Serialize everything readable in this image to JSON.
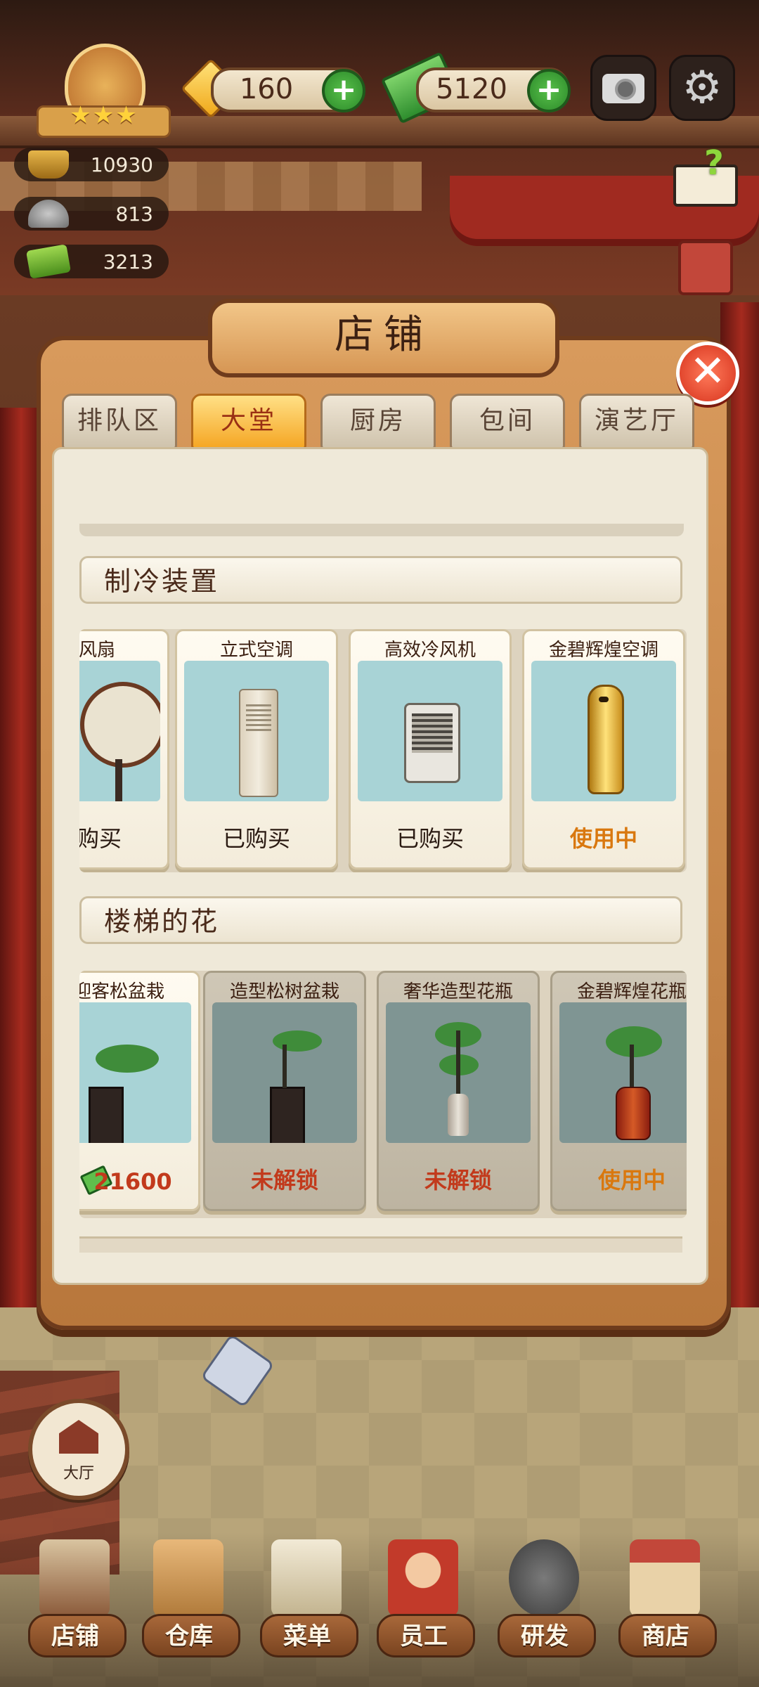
{
  "hud": {
    "gems": "160",
    "cash": "5120",
    "stats": [
      "10930",
      "813",
      "3213"
    ]
  },
  "panel": {
    "title": "店铺",
    "tabs": [
      "排队区",
      "大堂",
      "厨房",
      "包间",
      "演艺厅"
    ],
    "active_tab_index": 1,
    "sections": [
      {
        "title": "制冷装置",
        "items": [
          {
            "name": "电风扇",
            "status": "已购买"
          },
          {
            "name": "立式空调",
            "status": "已购买"
          },
          {
            "name": "高效冷风机",
            "status": "已购买"
          },
          {
            "name": "金碧辉煌空调",
            "status": "使用中"
          }
        ]
      },
      {
        "title": "楼梯的花",
        "items": [
          {
            "name": "迎客松盆栽",
            "status": "21600"
          },
          {
            "name": "造型松树盆栽",
            "status": "未解锁"
          },
          {
            "name": "奢华造型花瓶",
            "status": "未解锁"
          },
          {
            "name": "金碧辉煌花瓶",
            "status": "使用中"
          }
        ]
      }
    ]
  },
  "hall_button": "大厅",
  "nav": [
    "店铺",
    "仓库",
    "菜单",
    "员工",
    "研发",
    "商店"
  ],
  "colors": {
    "accent_tab": "#f5a624",
    "using": "#d9780f",
    "locked": "#c23a1c",
    "panel_wood": "#c8864a"
  }
}
